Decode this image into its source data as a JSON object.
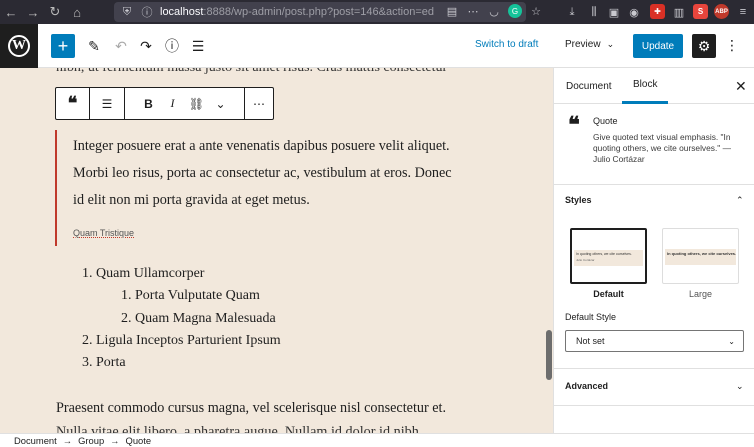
{
  "browser": {
    "url_host": "localhost",
    "url_rest": ":8888/wp-admin/post.php?post=146&action=ed",
    "ext_s_label": "S",
    "ext_abp_label": "ABP"
  },
  "toolbar": {
    "switch_to_draft": "Switch to draft",
    "preview": "Preview",
    "update": "Update"
  },
  "canvas": {
    "clipped_line": "nibh, ut fermentum massa justo sit amet risus. Cras mattis consectetur",
    "quote_lines": [
      "Integer posuere erat a ante venenatis dapibus posuere velit aliquet.",
      "Morbi leo risus, porta ac consectetur ac, vestibulum at eros. Donec",
      "id elit non mi porta gravida at eget metus."
    ],
    "quote_cite": "Quam Tristique",
    "list": [
      {
        "num": "1.",
        "text": "Quam Ullamcorper"
      },
      {
        "num": "1.",
        "text": "Porta Vulputate Quam"
      },
      {
        "num": "2.",
        "text": "Quam Magna Malesuada"
      },
      {
        "num": "2.",
        "text": "Ligula Inceptos Parturient Ipsum"
      },
      {
        "num": "3.",
        "text": "Porta"
      }
    ],
    "paragraph": "Praesent commodo cursus magna, vel scelerisque nisl consectetur et.",
    "paragraph_clipped": "Nulla vitae elit libero, a pharetra augue. Nullam id dolor id nibh"
  },
  "sidebar": {
    "tab_document": "Document",
    "tab_block": "Block",
    "block_title": "Quote",
    "block_desc": "Give quoted text visual emphasis. \"In quoting others, we cite ourselves.\" — Julio Cortázar",
    "styles_heading": "Styles",
    "style_default": "Default",
    "style_large": "Large",
    "style_preview_text": "In quoting others, we cite ourselves.",
    "style_preview_cite": "Julio Cortázar",
    "default_style_label": "Default Style",
    "default_style_value": "Not set",
    "advanced_heading": "Advanced"
  },
  "footer": {
    "crumbs": [
      "Document",
      "Group",
      "Quote"
    ]
  }
}
